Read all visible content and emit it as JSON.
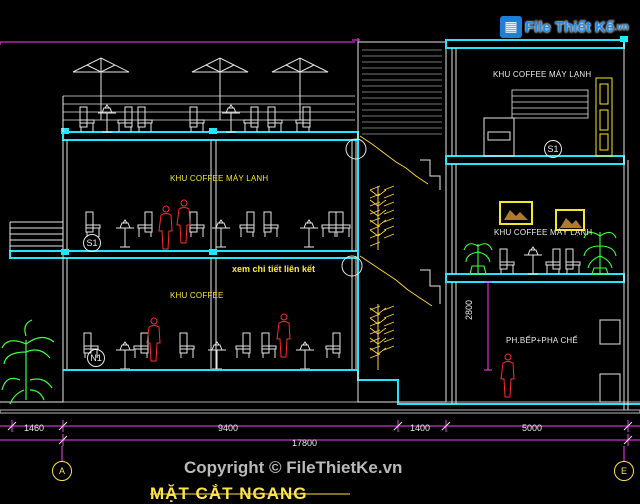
{
  "watermark": {
    "logo_text": "File Thiết Kế",
    "logo_suffix": ".vn",
    "copyright": "Copyright © FileThietKe.vn"
  },
  "drawing_title": "MẶT CẮT NGANG",
  "rooms": {
    "top_right": "KHU COFFEE MÁY LẠNH",
    "first_floor": "KHU COFFEE MÁY LẠNH",
    "ground_floor": "KHU COFFEE",
    "right_mid": "KHU COFFEE MÁY LẠNH",
    "kitchen": "PH.BẾP+PHA CHẾ"
  },
  "note": "xem chi tiết liên kết",
  "level_tags": [
    "S1",
    "S1",
    "N1"
  ],
  "dimensions": {
    "segments": [
      "1460",
      "9400",
      "1400",
      "5000"
    ],
    "total": "17800",
    "height": "2800"
  },
  "axes": [
    "A",
    "E"
  ],
  "colors": {
    "slab": "#22e5ff",
    "line": "#e6e6e6",
    "dim": "#ff3cff",
    "figure": "#ff2b2b",
    "plant": "#3cff3c",
    "stair": "#ffd23c",
    "note": "#ffee33",
    "axis": "#ffe34a"
  }
}
